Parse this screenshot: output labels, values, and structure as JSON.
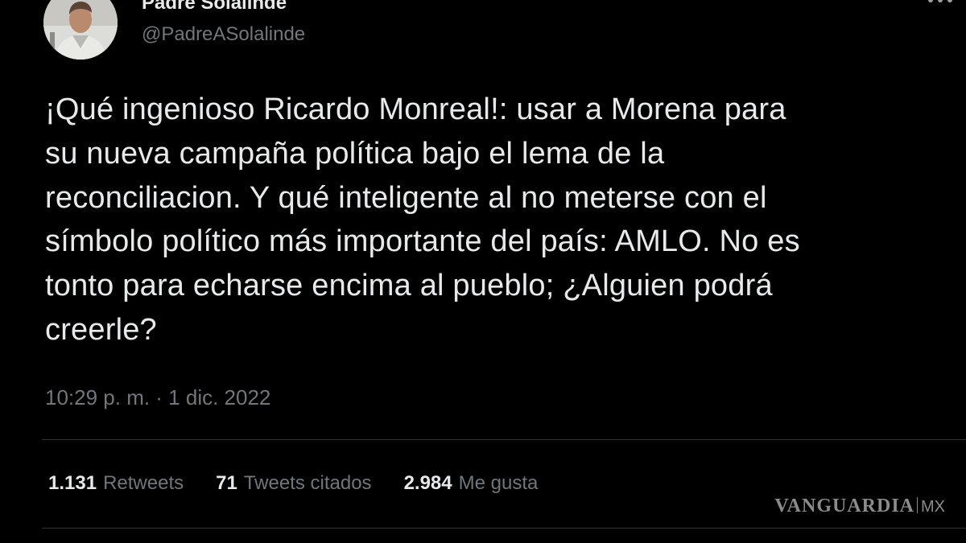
{
  "tweet": {
    "author": {
      "display_name": "Padre Solalinde",
      "handle": "@PadreASolalinde"
    },
    "text": "¡Qué ingenioso Ricardo Monreal!: usar a Morena para\nsu nueva campaña política bajo el lema de la\nreconciliacion. Y qué inteligente al no meterse con el\nsímbolo político más importante del país: AMLO. No es\ntonto para echarse encima al pueblo; ¿Alguien podrá\ncreerle?",
    "timestamp": "10:29 p. m. · 1 dic. 2022",
    "stats": {
      "retweets": {
        "count": "1.131",
        "label": "Retweets"
      },
      "quotes": {
        "count": "71",
        "label": "Tweets citados"
      },
      "likes": {
        "count": "2.984",
        "label": "Me gusta"
      }
    }
  },
  "watermark": {
    "brand": "VANGUARDIA",
    "suffix": "MX"
  },
  "icons": {
    "more": "more-options-icon"
  },
  "colors": {
    "background": "#000000",
    "primary_text": "#e7e9ea",
    "secondary_text": "#71767b",
    "divider": "#2f3336"
  }
}
